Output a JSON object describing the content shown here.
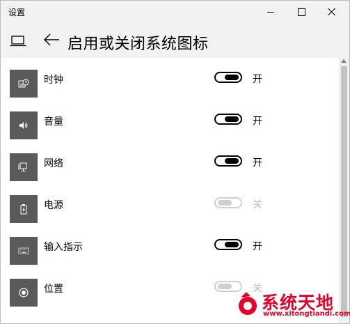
{
  "window": {
    "title": "设置"
  },
  "header": {
    "title": "启用或关闭系统图标"
  },
  "items": [
    {
      "label": "时钟",
      "state": "开",
      "on": true,
      "icon": "clock-icon"
    },
    {
      "label": "音量",
      "state": "开",
      "on": true,
      "icon": "volume-icon"
    },
    {
      "label": "网络",
      "state": "开",
      "on": true,
      "icon": "network-icon"
    },
    {
      "label": "电源",
      "state": "关",
      "on": false,
      "icon": "battery-icon"
    },
    {
      "label": "输入指示",
      "state": "开",
      "on": true,
      "icon": "keyboard-icon"
    },
    {
      "label": "位置",
      "state": "关",
      "on": false,
      "icon": "location-icon"
    }
  ],
  "watermark": {
    "text": "系统天地",
    "url": "www.xitongtiandi.com"
  },
  "colors": {
    "tile": "#5a5a5a",
    "titlebar": "#f2f2f2",
    "toggle_on": "#000000",
    "toggle_off": "#cfcfcf",
    "watermark": "#e4002b"
  }
}
